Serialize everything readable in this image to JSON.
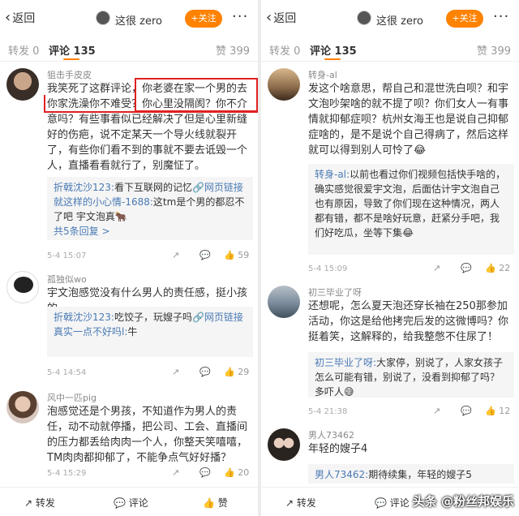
{
  "topbar": {
    "back_label": "返回",
    "title": "这很 zero",
    "follow_label": "+关注",
    "more": "···"
  },
  "tabs": {
    "repost": "转发 0",
    "comment": "评论 135",
    "like": "赞 399"
  },
  "left": {
    "comments": [
      {
        "user": "狙击手皮皮",
        "text": "我笑死了这群评论，你老婆在家一个男的去你家洗澡你不难受？你心里没隔阂？你不介意吗？有些事看似已经解决了但是心里新缝好的伤疤，说不定某天一个导火线就裂开了，有些你们看不到的事就不要去诋毁一个人，直播看看就行了，别魔怔了。",
        "replies": [
          {
            "user": "折戟沈沙123:",
            "text": "看下互联网的记忆",
            "link": "网页链接"
          },
          {
            "user": "就这样的小心情-1688:",
            "text": "这tm是个男的都忍不了吧 宇文泡真🐂"
          }
        ],
        "more_replies": "共5条回复 >",
        "time": "5-4 15:07",
        "likes": "59"
      },
      {
        "user": "孤独似wo",
        "text": "宇文泡感觉没有什么男人的责任感，挺小孩的",
        "replies": [
          {
            "user": "折戟沈沙123:",
            "text": "吃饺子，玩嫂子吗",
            "link": "网页链接"
          },
          {
            "user": "真实一点不好吗l:",
            "text": "牛"
          }
        ],
        "time": "5-4 14:54",
        "likes": "29"
      },
      {
        "user": "风中一匹pig",
        "text": "泡感觉还是个男孩，不知道作为男人的责任，动不动就停播，把公司、工会、直播间的压力都丢给肉肉一个人，你整天笑嘻嘻，TM肉肉都抑郁了，不能争点气好好播？",
        "time": "5-4 15:29",
        "likes": "20"
      }
    ]
  },
  "right": {
    "comments": [
      {
        "user": "转身-al",
        "text": "发这个啥意思，帮自己和混世洗白呗？和宇文泡吵架啥的就不提了呗？你们女人一有事情就抑郁症呗？杭州女海王也是说自己抑郁症啥的，是不是说个自己得病了，然后这样就可以得到别人可怜了😂",
        "replies": [
          {
            "user": "转身-al:",
            "text": "以前也看过你们视频包括快手啥的，确实感觉很爱宇文泡，后面估计宇文泡自己也有原因，导致了你们现在这种情况，两人都有错，都不是啥好玩意，赶紧分手吧，我们好吃瓜，坐等下集😂"
          }
        ],
        "time": "5-4 15:09",
        "likes": "22"
      },
      {
        "user": "初三毕业了呀",
        "text": "还想呢，怎么夏天泡还穿长袖在250那参加活动，你这是给他拷完后发的这微博吗？你挺着笑，这解释的，给我整憋不住尿了！",
        "replies": [
          {
            "user": "初三毕业了呀:",
            "text": "大家停，别说了，人家女孩子怎么可能有错，别说了，没看到抑郁了吗？多吓人😅"
          }
        ],
        "time": "5-4 21:38",
        "likes": "12"
      },
      {
        "user": "男人73462",
        "text": "年轻的嫂子4",
        "replies": [
          {
            "user": "男人73462:",
            "text": "期待续集，年轻的嫂子5"
          }
        ]
      }
    ]
  },
  "bottombar": {
    "repost": "转发",
    "comment": "评论",
    "like": "赞"
  },
  "watermark": "头条 @粉丝邦娱乐",
  "colors": {
    "accent": "#ff8200",
    "link": "#4a7ab5",
    "highlight": "#e02020"
  }
}
